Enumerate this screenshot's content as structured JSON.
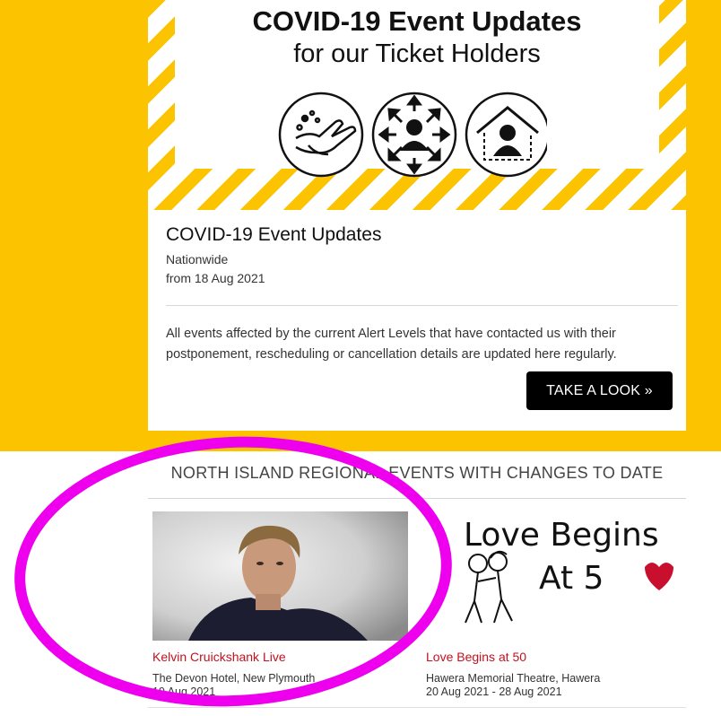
{
  "hero": {
    "title": "COVID-19 Event Updates",
    "subtitle": "for our Ticket Holders",
    "icons": [
      "hand-washing-icon",
      "social-distancing-icon",
      "stay-home-icon"
    ]
  },
  "event": {
    "title": "COVID-19 Event Updates",
    "location": "Nationwide",
    "date": "from 18 Aug 2021",
    "description": "All events affected by the current Alert Levels that have contacted us with their postponement, rescheduling or cancellation details are updated here regularly.",
    "cta_label": "TAKE A LOOK »"
  },
  "section": {
    "heading": "NORTH ISLAND REGIONAL EVENTS WITH CHANGES TO DATE"
  },
  "tiles": [
    {
      "title": "Kelvin Cruickshank Live",
      "venue": "The Devon Hotel, New Plymouth",
      "dates": "19 Aug 2021"
    },
    {
      "title": "Love Begins at 50",
      "venue": "Hawera Memorial Theatre, Hawera",
      "dates": "20 Aug 2021 - 28 Aug 2021",
      "poster_text_line1": "Love Begins",
      "poster_text_line2": "At 5"
    }
  ],
  "colors": {
    "accent_yellow": "#fcc400",
    "link_red": "#c1121f",
    "highlight_magenta": "#ee00ee"
  }
}
